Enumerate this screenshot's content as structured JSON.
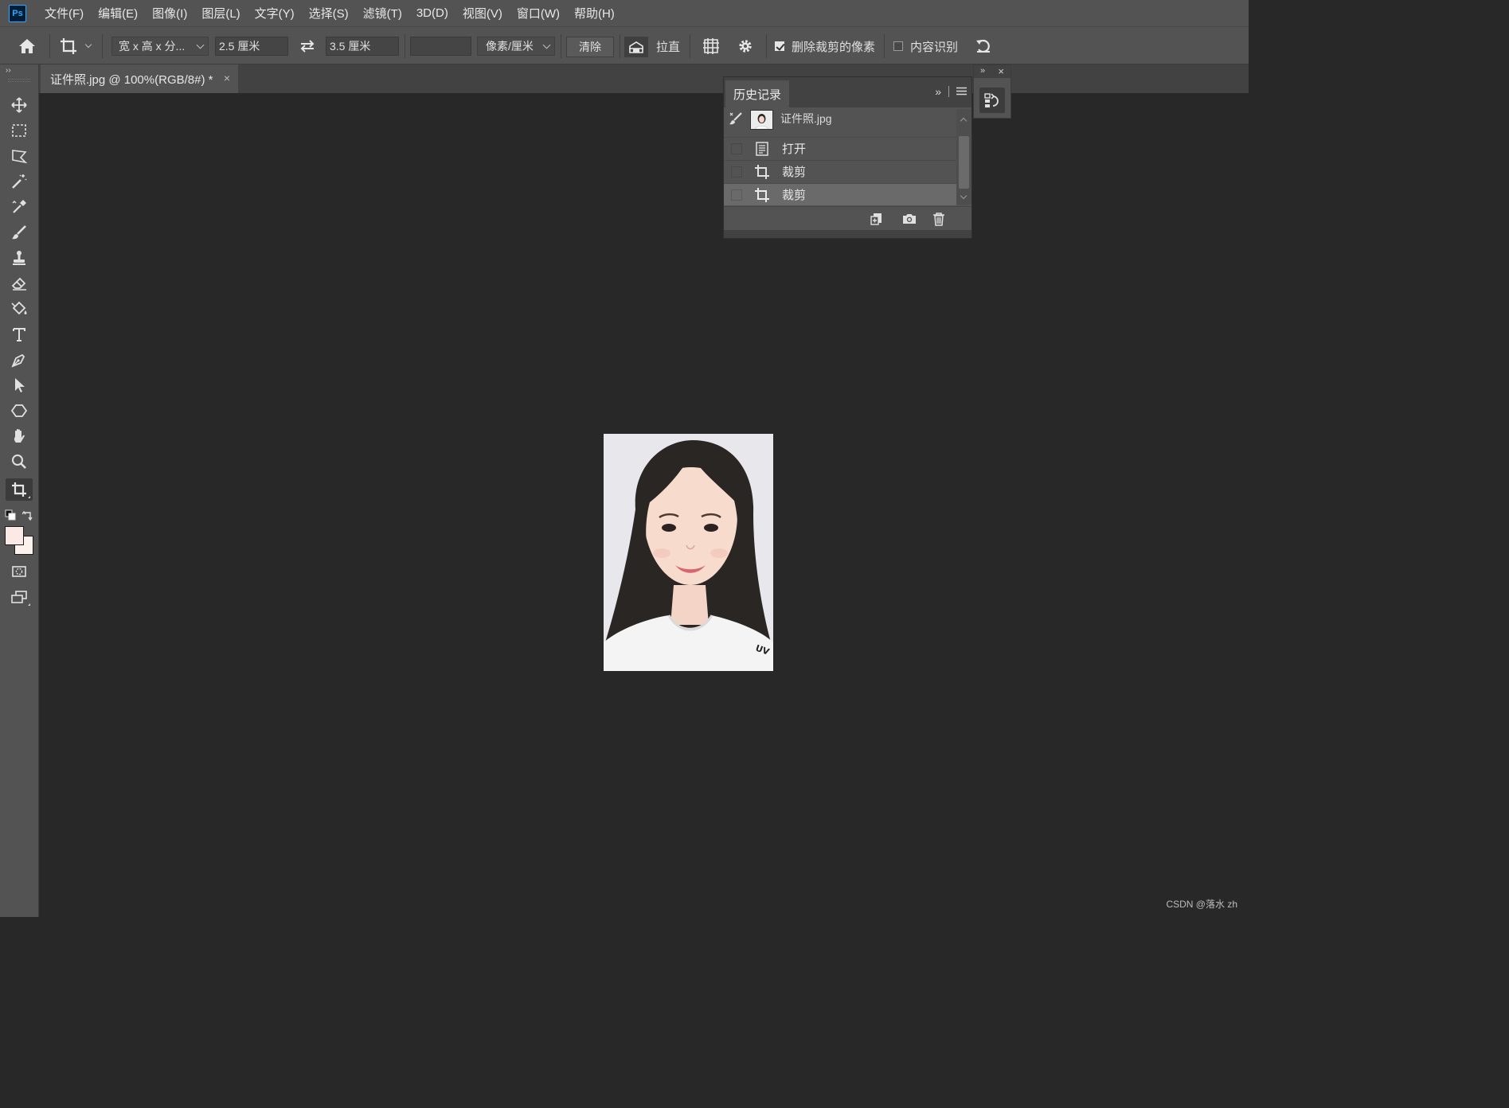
{
  "app": {
    "logo_text": "Ps"
  },
  "menu": [
    "文件(F)",
    "编辑(E)",
    "图像(I)",
    "图层(L)",
    "文字(Y)",
    "选择(S)",
    "滤镜(T)",
    "3D(D)",
    "视图(V)",
    "窗口(W)",
    "帮助(H)"
  ],
  "options": {
    "ratio_preset": "宽 x 高 x 分...",
    "width_value": "2.5 厘米",
    "height_value": "3.5 厘米",
    "resolution_value": "",
    "unit_select": "像素/厘米",
    "clear_label": "清除",
    "straighten_label": "拉直",
    "delete_cropped_label": "删除裁剪的像素",
    "delete_cropped_checked": true,
    "content_aware_label": "内容识别",
    "content_aware_checked": false
  },
  "document": {
    "tab_title": "证件照.jpg @ 100%(RGB/8#) *",
    "close_glyph": "×"
  },
  "history_panel": {
    "title": "历史记录",
    "snapshot_name": "证件照.jpg",
    "steps": [
      {
        "label": "打开",
        "icon": "document-icon",
        "selected": false
      },
      {
        "label": "裁剪",
        "icon": "crop-icon",
        "selected": false
      },
      {
        "label": "裁剪",
        "icon": "crop-icon",
        "selected": true
      }
    ]
  },
  "footer": {
    "watermark": "CSDN @落水 zh"
  },
  "colors": {
    "foreground": "#fbe9e6",
    "background": "#fdf1ee",
    "accent": "#31a8ff"
  }
}
